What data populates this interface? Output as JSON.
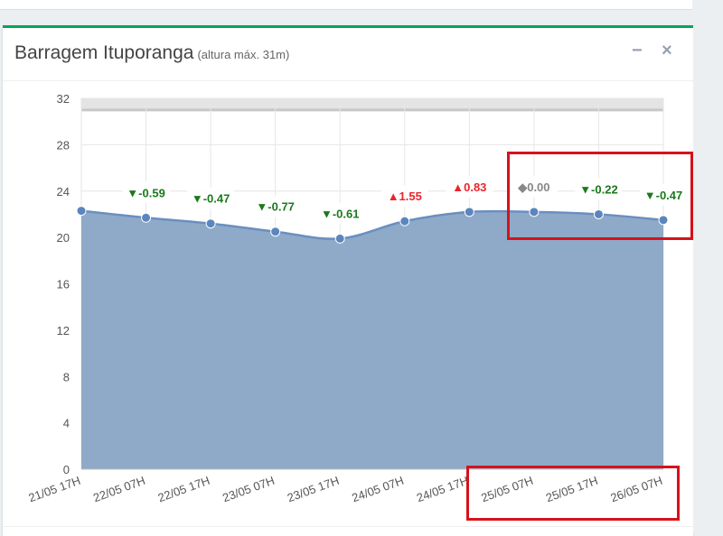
{
  "panel": {
    "title": "Barragem Ituporanga",
    "subtitle": "(altura máx. 31m)",
    "minimize_icon": "−",
    "close_icon": "×"
  },
  "chart_data": {
    "type": "area",
    "title": "Barragem Ituporanga",
    "subtitle": "(altura máx. 31m)",
    "categories": [
      "21/05 17H",
      "22/05 07H",
      "22/05 17H",
      "23/05 07H",
      "23/05 17H",
      "24/05 07H",
      "24/05 17H",
      "25/05 07H",
      "25/05 17H",
      "26/05 07H"
    ],
    "values": [
      22.3,
      21.7,
      21.2,
      20.5,
      19.9,
      21.4,
      22.2,
      22.2,
      22.0,
      21.5
    ],
    "labels": [
      {
        "text": "",
        "dir": "none"
      },
      {
        "text": "▼-0.59",
        "dir": "down"
      },
      {
        "text": "▼-0.47",
        "dir": "down"
      },
      {
        "text": "▼-0.77",
        "dir": "down"
      },
      {
        "text": "▼-0.61",
        "dir": "down"
      },
      {
        "text": "▲1.55",
        "dir": "up"
      },
      {
        "text": "▲0.83",
        "dir": "up"
      },
      {
        "text": "◆0.00",
        "dir": "flat"
      },
      {
        "text": "▼-0.22",
        "dir": "down"
      },
      {
        "text": "▼-0.47",
        "dir": "down"
      }
    ],
    "ylim": [
      0,
      32
    ],
    "yticks": [
      0,
      4,
      8,
      12,
      16,
      20,
      24,
      28,
      32
    ],
    "max_height": 31,
    "grid": true,
    "colors": {
      "area": "#8faac8",
      "line": "#6a8fc0",
      "marker": "#5b86bd",
      "down": "#1a7a1a",
      "up": "#e8262b",
      "flat": "#888888",
      "max_band": "#e4e4e4",
      "highlight": "#d6121b"
    }
  }
}
